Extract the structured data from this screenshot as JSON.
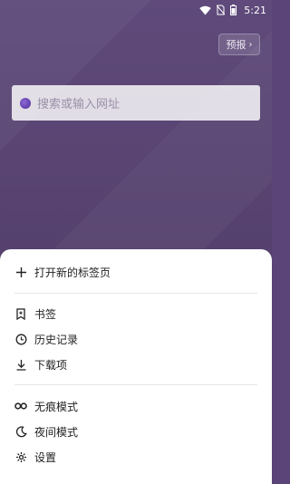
{
  "status_bar": {
    "time": "5:21"
  },
  "header": {
    "forecast_label": "预报",
    "forecast_chevron": "›"
  },
  "search": {
    "placeholder": "搜索或输入网址"
  },
  "menu": {
    "new_tab": "打开新的标签页",
    "bookmarks": "书签",
    "history": "历史记录",
    "downloads": "下载项",
    "incognito": "无痕模式",
    "night_mode": "夜间模式",
    "settings": "设置"
  },
  "icons": {
    "new_tab": "plus-icon",
    "bookmarks": "bookmark-icon",
    "history": "clock-icon",
    "downloads": "download-icon",
    "incognito": "incognito-mask-icon",
    "night_mode": "moon-icon",
    "settings": "gear-icon"
  },
  "colors": {
    "background": "#5b4477",
    "sheet": "#ffffff",
    "text": "#222222"
  }
}
